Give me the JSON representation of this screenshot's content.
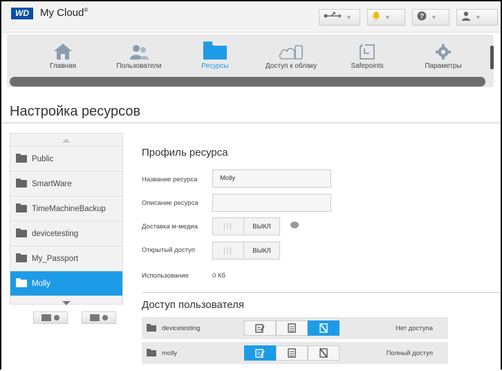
{
  "app": {
    "brand": "WD",
    "name": "My Cloud",
    "trademark": "®"
  },
  "nav": [
    {
      "label": "Главная",
      "icon": "home-icon",
      "active": false
    },
    {
      "label": "Пользователи",
      "icon": "users-icon",
      "active": false
    },
    {
      "label": "Ресурсы",
      "icon": "folder-icon",
      "active": true
    },
    {
      "label": "Доступ к облаку",
      "icon": "cloud-access-icon",
      "active": false
    },
    {
      "label": "Safepoints",
      "icon": "safepoints-icon",
      "active": false
    },
    {
      "label": "Параметры",
      "icon": "gear-icon",
      "active": false
    }
  ],
  "page_title": "Настройка ресурсов",
  "sidebar": {
    "shares": [
      "Public",
      "SmartWare",
      "TimeMachineBackup",
      "devicetesting",
      "My_Passport",
      "Molly"
    ],
    "selected": "Molly"
  },
  "profile": {
    "heading": "Профиль ресурса",
    "name_label": "Название ресурса",
    "name_value": "Molly",
    "desc_label": "Описание ресурса",
    "desc_value": "",
    "media_label": "Доставка м-медиа",
    "media_state": "ВЫКЛ",
    "public_label": "Открытый доступ",
    "public_state": "ВЫКЛ",
    "usage_label": "Использование",
    "usage_value": "0 Кб"
  },
  "access": {
    "heading": "Доступ пользователя",
    "rows": [
      {
        "user": "devicetesting",
        "status": "Нет доступа",
        "active_perm": "none"
      },
      {
        "user": "molly",
        "status": "Полный доступ",
        "active_perm": "full"
      }
    ]
  },
  "colors": {
    "accent": "#1e9be6",
    "brand": "#0a4fa6"
  }
}
